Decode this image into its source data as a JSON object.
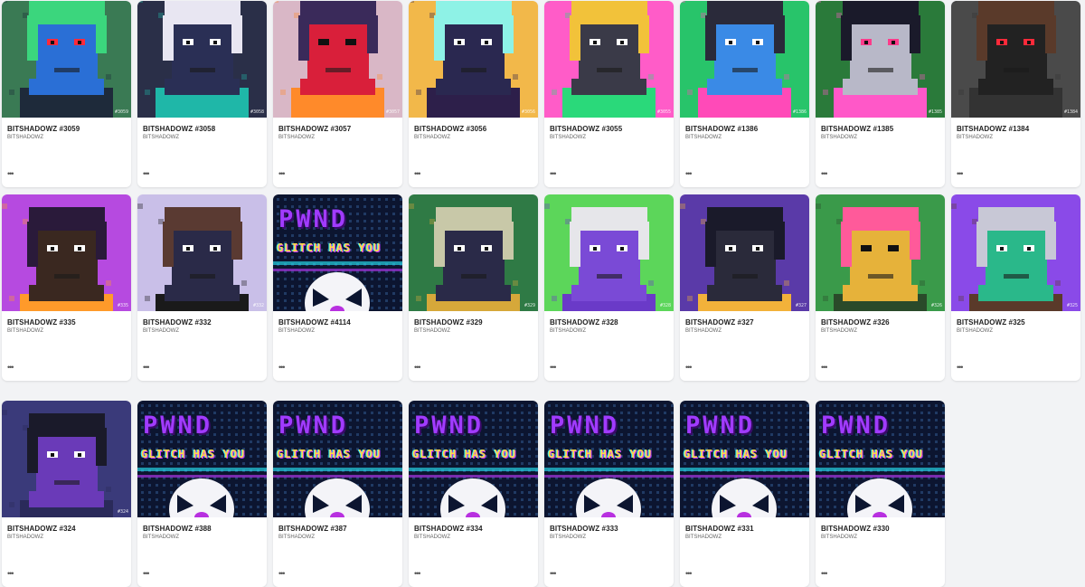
{
  "collection_name": "BITSHADOWZ",
  "more_label": "•••",
  "pwnd_text": "PWND",
  "pwnd_subtext": "GLITCH HAS YOU",
  "cards": [
    {
      "title": "BITSHADOWZ #3059",
      "badge": "#3059",
      "variant": "character",
      "bg": "#3a7a54",
      "hair": "#3bd67d",
      "skin": "#2a6fd6",
      "eyes": "#ff2a3a",
      "accent": "#1e2a3a"
    },
    {
      "title": "BITSHADOWZ #3058",
      "badge": "#3058",
      "variant": "character",
      "bg": "#2a2f48",
      "hair": "#e8e6f2",
      "skin": "#2a2f55",
      "eyes": "#ffffff",
      "accent": "#1fb7a8"
    },
    {
      "title": "BITSHADOWZ #3057",
      "badge": "#3057",
      "variant": "character",
      "bg": "#d9b7c6",
      "hair": "#3a2a5a",
      "skin": "#d91f3a",
      "eyes": "#111111",
      "accent": "#ff8a2a"
    },
    {
      "title": "BITSHADOWZ #3056",
      "badge": "#3056",
      "variant": "character",
      "bg": "#f2b84a",
      "hair": "#8ef2e6",
      "skin": "#2a2850",
      "eyes": "#ffffff",
      "accent": "#2d1f4a"
    },
    {
      "title": "BITSHADOWZ #3055",
      "badge": "#3055",
      "variant": "character",
      "bg": "#ff5cc8",
      "hair": "#f2c23a",
      "skin": "#3a3a48",
      "eyes": "#ffffff",
      "accent": "#2ad97a"
    },
    {
      "title": "BITSHADOWZ #1386",
      "badge": "#1386",
      "variant": "character",
      "bg": "#28c46a",
      "hair": "#2a2a3a",
      "skin": "#3a8ae6",
      "eyes": "#ffffff",
      "accent": "#ff4ab8"
    },
    {
      "title": "BITSHADOWZ #1385",
      "badge": "#1385",
      "variant": "character",
      "bg": "#2a7a3a",
      "hair": "#1a1a2a",
      "skin": "#b8b8c8",
      "eyes": "#ff3a8a",
      "accent": "#ff58c8"
    },
    {
      "title": "BITSHADOWZ #1384",
      "badge": "#1384",
      "variant": "character",
      "bg": "#4a4a4a",
      "hair": "#5a3a2a",
      "skin": "#222222",
      "eyes": "#ff2a3a",
      "accent": "#333333"
    },
    {
      "title": "BITSHADOWZ #335",
      "badge": "#335",
      "variant": "character",
      "bg": "#b64ae0",
      "hair": "#2a1a3a",
      "skin": "#3a2820",
      "eyes": "#ffffff",
      "accent": "#ff9a2a"
    },
    {
      "title": "BITSHADOWZ #332",
      "badge": "#332",
      "variant": "character",
      "bg": "#c9bfe8",
      "hair": "#5a3a32",
      "skin": "#2a2a48",
      "eyes": "#ffffff",
      "accent": "#1a1a1a"
    },
    {
      "title": "BITSHADOWZ #4114",
      "badge": "",
      "variant": "pwnd"
    },
    {
      "title": "BITSHADOWZ #329",
      "badge": "#329",
      "variant": "character",
      "bg": "#2f7a45",
      "hair": "#c8c8a8",
      "skin": "#2a2a48",
      "eyes": "#ffffff",
      "accent": "#d6a83a"
    },
    {
      "title": "BITSHADOWZ #328",
      "badge": "#328",
      "variant": "character",
      "bg": "#5cd65a",
      "hair": "#e6e6ea",
      "skin": "#7a4ad6",
      "eyes": "#ffffff",
      "accent": "#6a3ac8"
    },
    {
      "title": "BITSHADOWZ #327",
      "badge": "#327",
      "variant": "character",
      "bg": "#5a3aa8",
      "hair": "#1a1a2a",
      "skin": "#2a2a3a",
      "eyes": "#ffffff",
      "accent": "#f2b23a"
    },
    {
      "title": "BITSHADOWZ #326",
      "badge": "#326",
      "variant": "character",
      "bg": "#3a9a4a",
      "hair": "#ff5a9a",
      "skin": "#e6b23a",
      "eyes": "#111111",
      "accent": "#2a4a2a"
    },
    {
      "title": "BITSHADOWZ #325",
      "badge": "#325",
      "variant": "character",
      "bg": "#8a4ae8",
      "hair": "#c8c8d6",
      "skin": "#2ab88a",
      "eyes": "#ffffff",
      "accent": "#5a3a2a"
    },
    {
      "title": "BITSHADOWZ #324",
      "badge": "#324",
      "variant": "character",
      "bg": "#3a3a7a",
      "hair": "#1a1a2a",
      "skin": "#6a3ab8",
      "eyes": "#ffffff",
      "accent": "#2a2a5a"
    },
    {
      "title": "BITSHADOWZ #388",
      "badge": "",
      "variant": "pwnd"
    },
    {
      "title": "BITSHADOWZ #387",
      "badge": "",
      "variant": "pwnd"
    },
    {
      "title": "BITSHADOWZ #334",
      "badge": "",
      "variant": "pwnd"
    },
    {
      "title": "BITSHADOWZ #333",
      "badge": "",
      "variant": "pwnd"
    },
    {
      "title": "BITSHADOWZ #331",
      "badge": "",
      "variant": "pwnd"
    },
    {
      "title": "BITSHADOWZ #330",
      "badge": "",
      "variant": "pwnd"
    }
  ]
}
